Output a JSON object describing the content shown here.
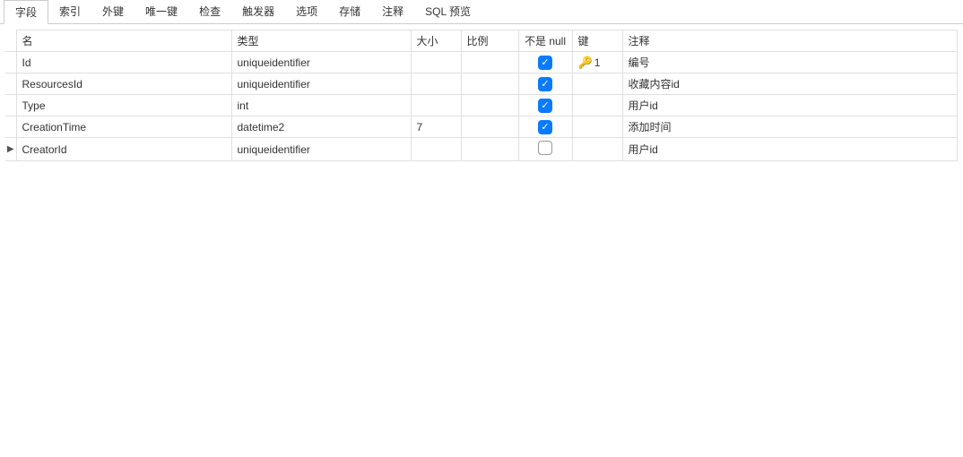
{
  "tabs": {
    "items": [
      {
        "label": "字段",
        "active": true
      },
      {
        "label": "索引",
        "active": false
      },
      {
        "label": "外键",
        "active": false
      },
      {
        "label": "唯一键",
        "active": false
      },
      {
        "label": "检查",
        "active": false
      },
      {
        "label": "触发器",
        "active": false
      },
      {
        "label": "选项",
        "active": false
      },
      {
        "label": "存储",
        "active": false
      },
      {
        "label": "注释",
        "active": false
      },
      {
        "label": "SQL 预览",
        "active": false
      }
    ]
  },
  "columns": {
    "name": "名",
    "type": "类型",
    "size": "大小",
    "scale": "比例",
    "not_null": "不是 null",
    "key": "键",
    "comment": "注释"
  },
  "rows": [
    {
      "marker": "",
      "name": "Id",
      "type": "uniqueidentifier",
      "size": "",
      "scale": "",
      "not_null": true,
      "key": "1",
      "is_pk": true,
      "comment": "编号"
    },
    {
      "marker": "",
      "name": "ResourcesId",
      "type": "uniqueidentifier",
      "size": "",
      "scale": "",
      "not_null": true,
      "key": "",
      "is_pk": false,
      "comment": "收藏内容id"
    },
    {
      "marker": "",
      "name": "Type",
      "type": "int",
      "size": "",
      "scale": "",
      "not_null": true,
      "key": "",
      "is_pk": false,
      "comment": "用户id"
    },
    {
      "marker": "",
      "name": "CreationTime",
      "type": "datetime2",
      "size": "7",
      "scale": "",
      "not_null": true,
      "key": "",
      "is_pk": false,
      "comment": "添加时间"
    },
    {
      "marker": "▶",
      "name": "CreatorId",
      "type": "uniqueidentifier",
      "size": "",
      "scale": "",
      "not_null": false,
      "key": "",
      "is_pk": false,
      "comment": "用户id"
    }
  ]
}
